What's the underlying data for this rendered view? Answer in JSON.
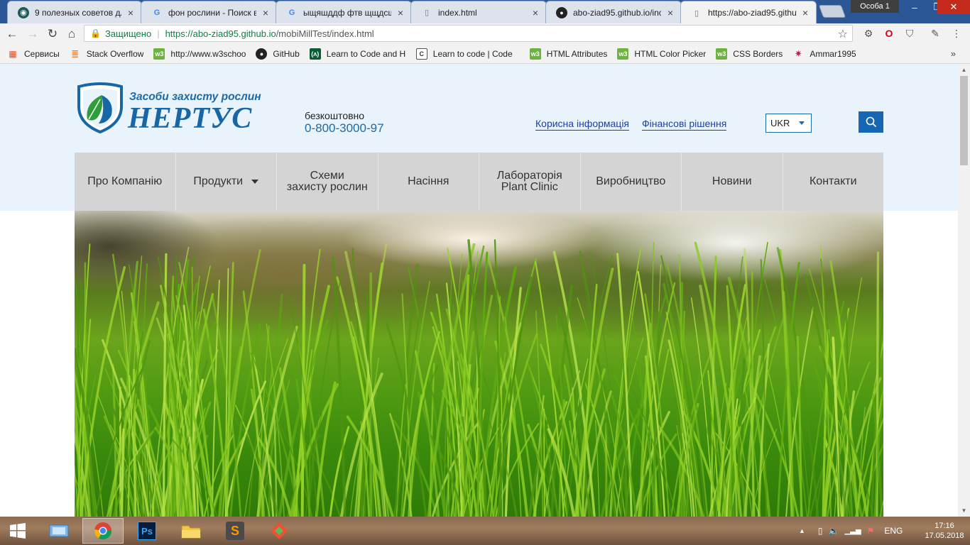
{
  "browser": {
    "tabs": [
      {
        "label": "9 полезных советов для",
        "favicon": "opera-icon"
      },
      {
        "label": "фон рослини - Поиск в",
        "favicon": "google-icon"
      },
      {
        "label": "ыщяшддф фтв щщдсщкг",
        "favicon": "google-icon"
      },
      {
        "label": "index.html",
        "favicon": "file-icon"
      },
      {
        "label": "abo-ziad95.github.io/inc",
        "favicon": "github-icon"
      },
      {
        "label": "https://abo-ziad95.githu",
        "favicon": "file-icon"
      }
    ],
    "profile": "Особа 1",
    "secure_label": "Защищено",
    "url_host": "https://abo-ziad95.github.io",
    "url_path": "/mobiMillTest/index.html",
    "bookmarks": [
      {
        "label": "Сервисы",
        "icon": "apps-icon",
        "color": "#e44d26"
      },
      {
        "label": "Stack Overflow",
        "icon": "stackoverflow-icon",
        "color": "#f48024"
      },
      {
        "label": "http://www.w3schoo",
        "icon": "w3schools-icon",
        "color": "#6cb33f"
      },
      {
        "label": "GitHub",
        "icon": "github-icon",
        "color": "#222222"
      },
      {
        "label": "Learn to Code and H",
        "icon": "freecodecamp-icon",
        "color": "#0a5c36"
      },
      {
        "label": "Learn to code | Code",
        "icon": "codecademy-icon",
        "color": "#444444"
      },
      {
        "label": "HTML Attributes",
        "icon": "w3schools-icon",
        "color": "#6cb33f"
      },
      {
        "label": "HTML Color Picker",
        "icon": "w3schools-icon",
        "color": "#6cb33f"
      },
      {
        "label": "CSS Borders",
        "icon": "w3schools-icon",
        "color": "#6cb33f"
      },
      {
        "label": "Ammar1995",
        "icon": "star-icon",
        "color": "#c2185b"
      }
    ],
    "more_bookmarks": "»"
  },
  "site": {
    "logo": {
      "tagline": "Засоби захисту рослин",
      "name": "НЕРТУС"
    },
    "phone": {
      "label": "безкоштовно",
      "number": "0-800-3000-97"
    },
    "top_links": [
      "Корисна інформація",
      "Фінансові рішення"
    ],
    "language": "UKR",
    "nav": [
      {
        "label": "Про Компанію",
        "dropdown": false
      },
      {
        "label": "Продукти",
        "dropdown": true
      },
      {
        "label": "Схеми\nзахисту рослин",
        "dropdown": false
      },
      {
        "label": "Насіння",
        "dropdown": false
      },
      {
        "label": "Лабораторія\nPlant Clinic",
        "dropdown": false
      },
      {
        "label": "Виробництво",
        "dropdown": false
      },
      {
        "label": "Новини",
        "dropdown": false
      },
      {
        "label": "Контакти",
        "dropdown": false
      }
    ],
    "colors": {
      "brand_blue": "#1766a6",
      "header_bg": "#e8f3fb",
      "nav_bg": "#d4d4d4"
    }
  },
  "taskbar": {
    "apps": [
      "windows-start-icon",
      "file-manager-icon",
      "chrome-icon",
      "photoshop-icon",
      "explorer-icon",
      "sublime-icon",
      "git-icon"
    ],
    "language": "ENG",
    "time": "17:16",
    "date": "17.05.2018"
  }
}
